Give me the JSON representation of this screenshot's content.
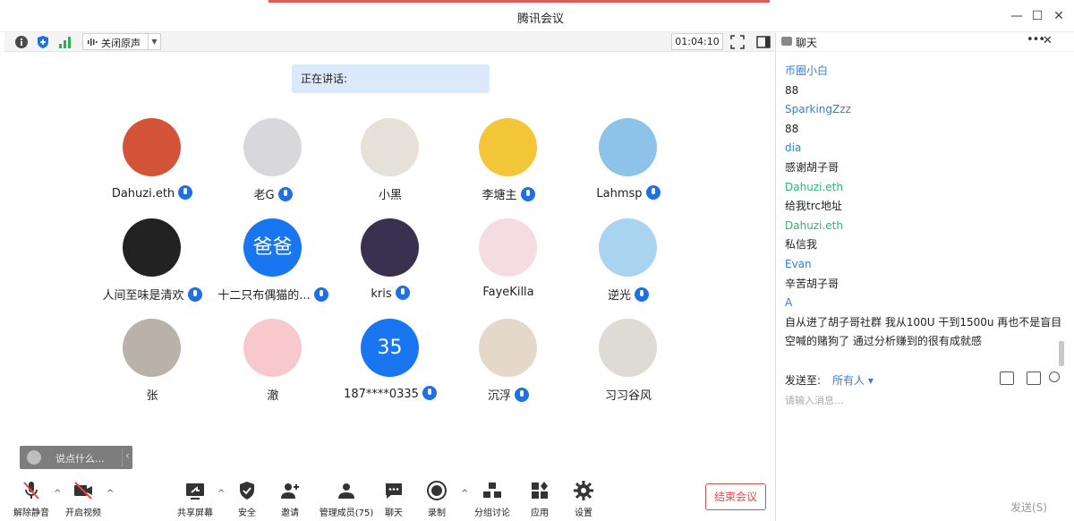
{
  "window": {
    "title": "腾讯会议"
  },
  "toolbar_top": {
    "audio_mode": "关闭原声",
    "timer": "01:04:10"
  },
  "video": {
    "speaking_label": "正在讲话:",
    "participants": [
      {
        "name": "Dahuzi.eth",
        "mic": true,
        "avatar": "#d4543a"
      },
      {
        "name": "老G",
        "mic": true,
        "avatar": "#d8d8dc"
      },
      {
        "name": "小黑",
        "mic": false,
        "avatar": "#e6e1d8"
      },
      {
        "name": "李塘主",
        "mic": true,
        "avatar": "#f3c63a"
      },
      {
        "name": "Lahmsp",
        "mic": true,
        "avatar": "#8fc2e8"
      },
      {
        "name": "人间至味是清欢",
        "mic": true,
        "avatar": "#222222"
      },
      {
        "name": "十二只布偶猫的...",
        "mic": true,
        "avatar": "#1976f0",
        "text": "爸爸"
      },
      {
        "name": "kris",
        "mic": true,
        "avatar": "#3a3050"
      },
      {
        "name": "FayeKilla",
        "mic": false,
        "avatar": "#f4dce2"
      },
      {
        "name": "逆光",
        "mic": true,
        "avatar": "#a9d3ef"
      },
      {
        "name": "张",
        "mic": false,
        "avatar": "#b8b2a8"
      },
      {
        "name": "澈",
        "mic": false,
        "avatar": "#f7c9cd"
      },
      {
        "name": "187****0335",
        "mic": true,
        "avatar": "#1976f0",
        "text": "35"
      },
      {
        "name": "沉浮",
        "mic": true,
        "avatar": "#e4d8c9"
      },
      {
        "name": "习习谷风",
        "mic": false,
        "avatar": "#dedbd5"
      }
    ],
    "say_placeholder": "说点什么..."
  },
  "bottom_bar": {
    "unmute": "解除静音",
    "start_video": "开启视频",
    "share_screen": "共享屏幕",
    "security": "安全",
    "invite": "邀请",
    "manage_members": "管理成员(75)",
    "chat": "聊天",
    "record": "录制",
    "breakout": "分组讨论",
    "apps": "应用",
    "settings": "设置",
    "end_meeting": "结束会议"
  },
  "chat": {
    "title": "聊天",
    "messages": [
      {
        "t": "sender",
        "v": "币圈小白"
      },
      {
        "t": "text",
        "v": "88"
      },
      {
        "t": "sender",
        "v": "SparkingZzz"
      },
      {
        "t": "text",
        "v": "88"
      },
      {
        "t": "sender",
        "v": "dia"
      },
      {
        "t": "text",
        "v": "感谢胡子哥"
      },
      {
        "t": "sender-green",
        "v": "Dahuzi.eth"
      },
      {
        "t": "text",
        "v": "给我trc地址"
      },
      {
        "t": "sender-green",
        "v": "Dahuzi.eth"
      },
      {
        "t": "text",
        "v": "私信我"
      },
      {
        "t": "sender",
        "v": "Evan"
      },
      {
        "t": "text",
        "v": "辛苦胡子哥"
      },
      {
        "t": "sender",
        "v": "A"
      },
      {
        "t": "text",
        "v": "自从进了胡子哥社群 我从100U 干到1500u 再也不是盲目"
      },
      {
        "t": "text",
        "v": "空喊的赌狗了 通过分析赚到的很有成就感"
      }
    ],
    "send_to_label": "发送至:",
    "send_to_value": "所有人",
    "input_placeholder": "请输入消息...",
    "send_button": "发送(S)"
  }
}
